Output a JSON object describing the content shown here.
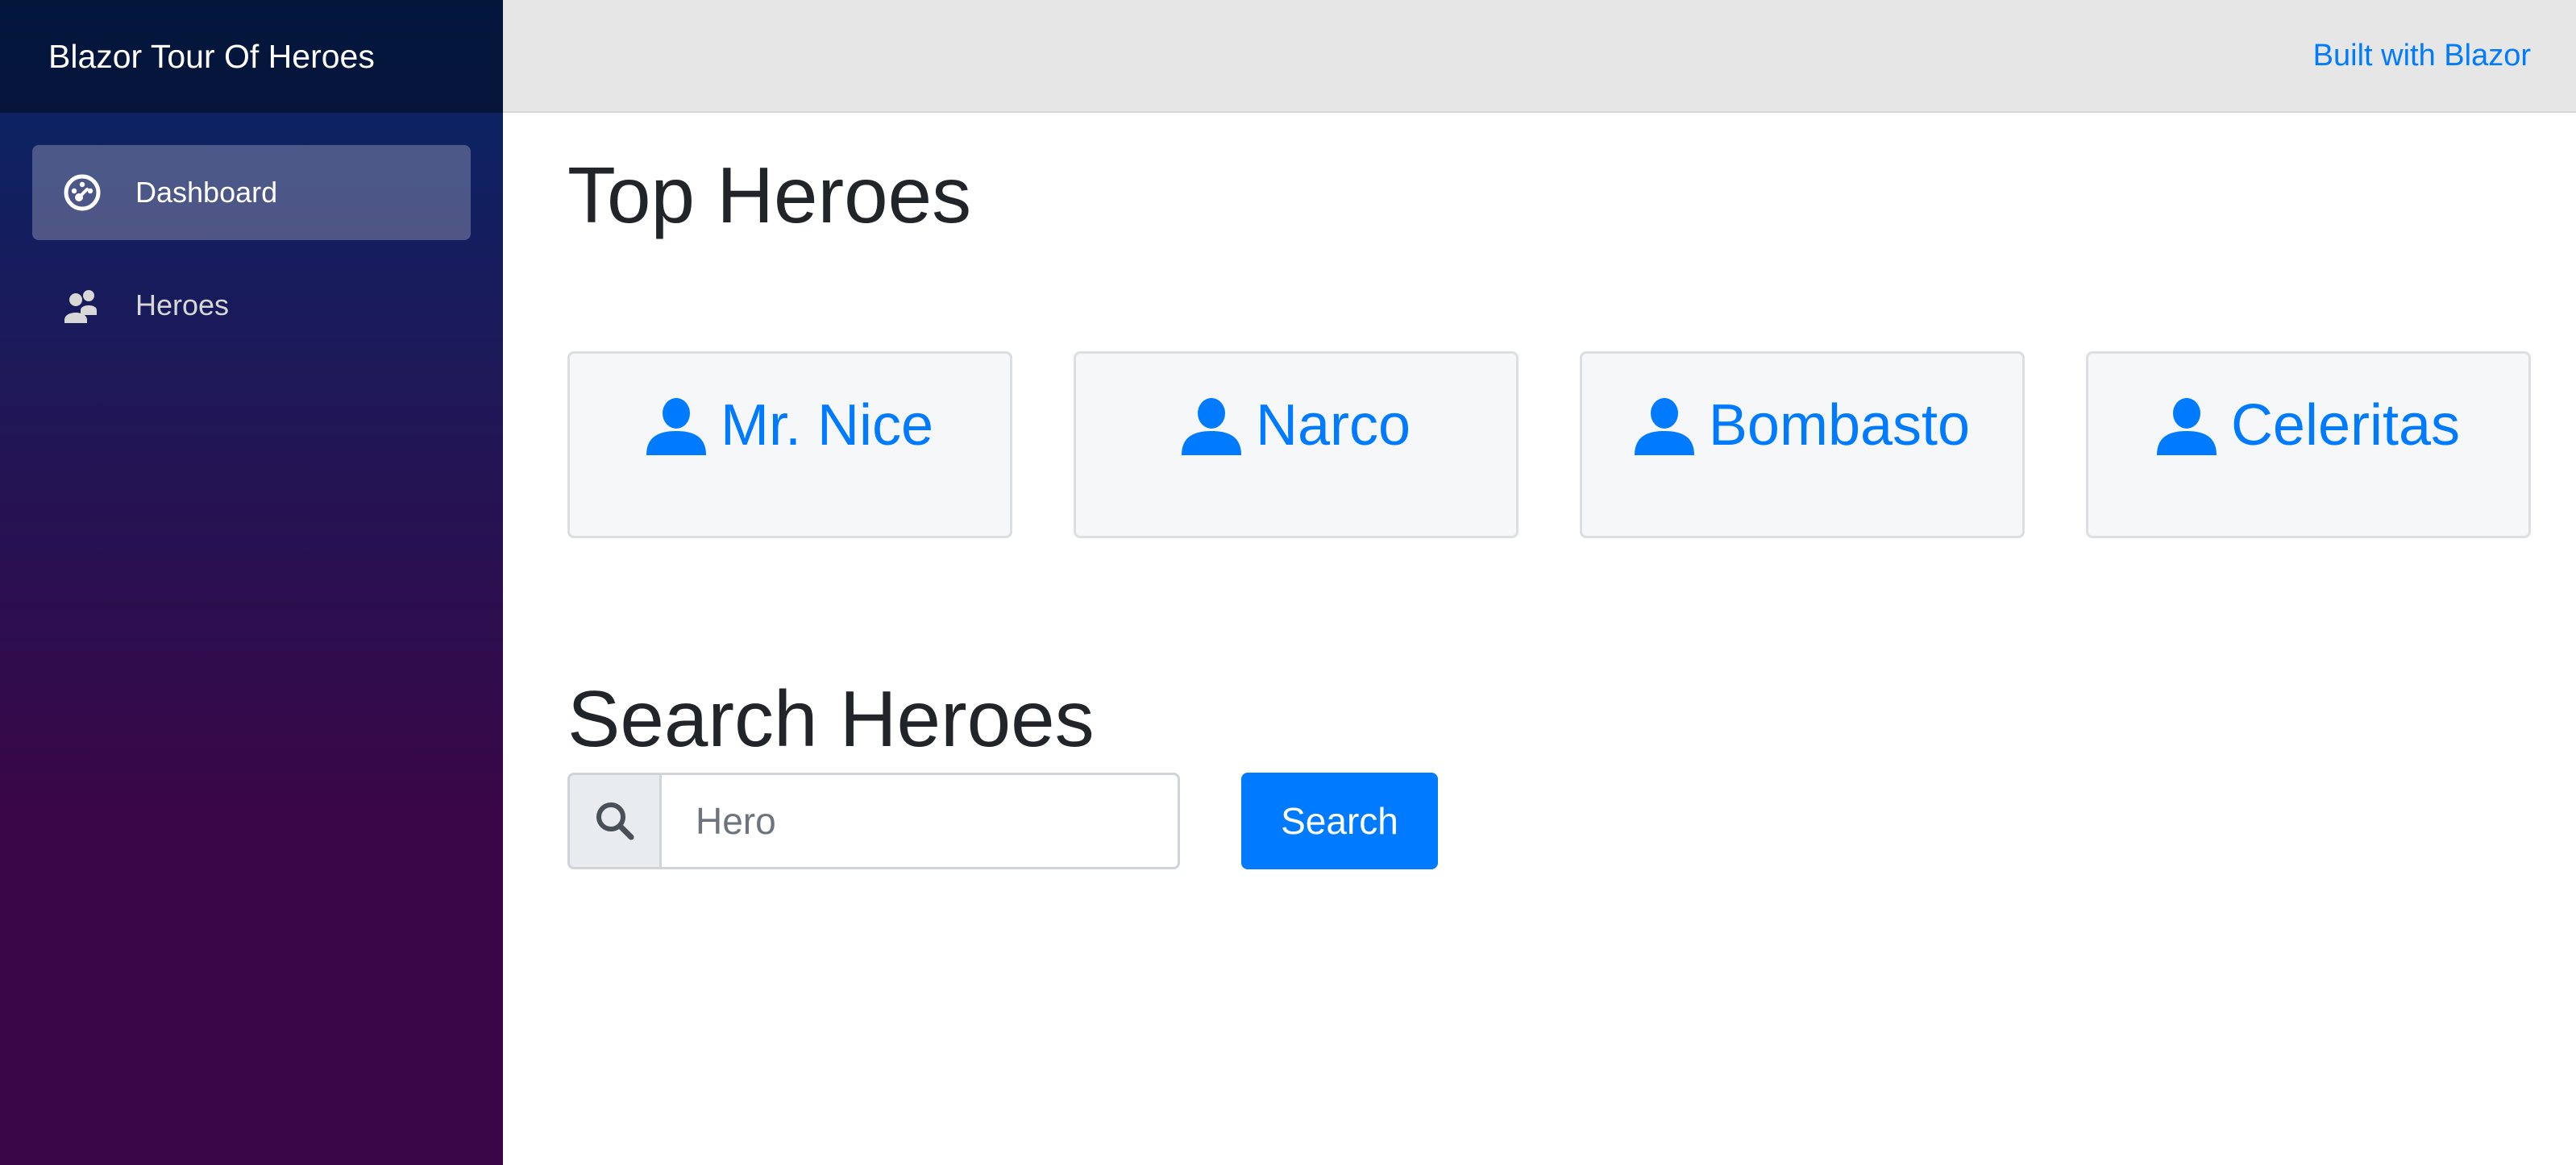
{
  "app": {
    "brand": "Blazor Tour Of Heroes"
  },
  "sidebar": {
    "items": [
      {
        "label": "Dashboard",
        "icon": "dashboard-icon",
        "active": true
      },
      {
        "label": "Heroes",
        "icon": "people-icon",
        "active": false
      }
    ]
  },
  "header": {
    "link": "Built with Blazor"
  },
  "dashboard": {
    "title": "Top Heroes",
    "heroes": [
      {
        "name": "Mr. Nice",
        "icon": "person-icon"
      },
      {
        "name": "Narco",
        "icon": "person-icon"
      },
      {
        "name": "Bombasto",
        "icon": "person-icon"
      },
      {
        "name": "Celeritas",
        "icon": "person-icon"
      }
    ]
  },
  "search": {
    "title": "Search Heroes",
    "placeholder": "Hero",
    "value": "",
    "button_label": "Search",
    "icon": "search-icon"
  },
  "colors": {
    "accent": "#007bff",
    "sidebar_top": "#052767",
    "sidebar_bottom": "#3a0647"
  }
}
